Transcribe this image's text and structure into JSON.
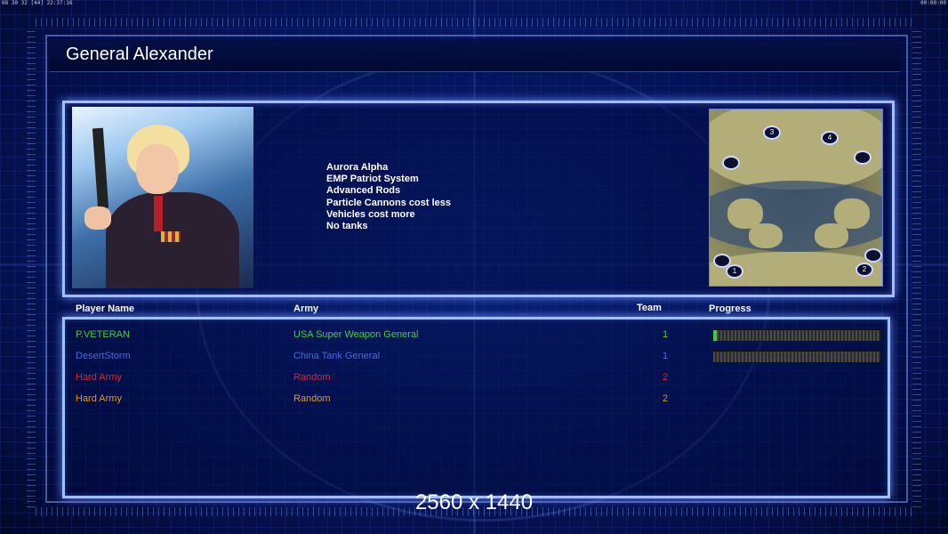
{
  "topbar": {
    "left_text": "08 30 32 [44] 22:37:16",
    "right_text": "00:00:00"
  },
  "title": "General Alexander",
  "general": {
    "features": [
      "Aurora Alpha",
      "EMP Patriot System",
      "Advanced Rods",
      "Particle Cannons cost less",
      "Vehicles cost more",
      "No tanks"
    ]
  },
  "minimap": {
    "spawns": [
      "1",
      "2",
      "3",
      "4",
      "",
      ""
    ]
  },
  "table": {
    "headers": {
      "player": "Player Name",
      "army": "Army",
      "team": "Team",
      "progress": "Progress"
    },
    "rows": [
      {
        "player": "P.VETERAN",
        "army": "USA Super Weapon General",
        "team": "1",
        "color": "#3fd23f",
        "progress": 0.02
      },
      {
        "player": "DesertStorm",
        "army": "China Tank General",
        "team": "1",
        "color": "#4a6ae0",
        "progress": 0.0
      },
      {
        "player": "Hard Army",
        "army": "Random",
        "team": "2",
        "color": "#e0242a",
        "progress": null
      },
      {
        "player": "Hard Army",
        "army": "Random",
        "team": "2",
        "color": "#e69a18",
        "progress": null
      }
    ]
  },
  "resolution": "2560 x 1440"
}
